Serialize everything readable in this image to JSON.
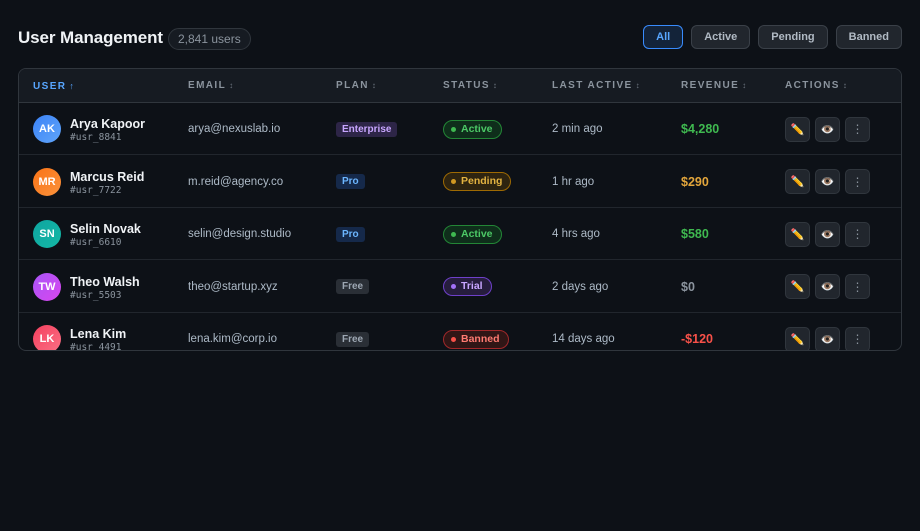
{
  "header": {
    "title": "User Management",
    "user_count": "2,841 users",
    "filters": [
      "All",
      "Active",
      "Pending",
      "Banned"
    ],
    "active_filter": "All"
  },
  "table": {
    "columns": [
      {
        "label": "USER",
        "sort": "↑",
        "sorted": true
      },
      {
        "label": "EMAIL",
        "sort": "↕",
        "sorted": false
      },
      {
        "label": "PLAN",
        "sort": "↕",
        "sorted": false
      },
      {
        "label": "STATUS",
        "sort": "↕",
        "sorted": false
      },
      {
        "label": "LAST ACTIVE",
        "sort": "↕",
        "sorted": false
      },
      {
        "label": "REVENUE",
        "sort": "↕",
        "sorted": false
      },
      {
        "label": "ACTIONS",
        "sort": "↕",
        "sorted": false
      }
    ],
    "rows": [
      {
        "initials": "AK",
        "avatar_colors": [
          "#3b82f6",
          "#60a5fa"
        ],
        "name": "Arya Kapoor",
        "id": "#usr_8841",
        "email": "arya@nexuslab.io",
        "plan": "Enterprise",
        "plan_type": "enterprise",
        "status": "Active",
        "status_type": "active",
        "last_active": "2 min ago",
        "revenue": "$4,280",
        "revenue_color": "#3fb950"
      },
      {
        "initials": "MR",
        "avatar_colors": [
          "#f97316",
          "#fb923c"
        ],
        "name": "Marcus Reid",
        "id": "#usr_7722",
        "email": "m.reid@agency.co",
        "plan": "Pro",
        "plan_type": "pro",
        "status": "Pending",
        "status_type": "pending",
        "last_active": "1 hr ago",
        "revenue": "$290",
        "revenue_color": "#e3a63c"
      },
      {
        "initials": "SN",
        "avatar_colors": [
          "#0ea5a0",
          "#14b8a6"
        ],
        "name": "Selin Novak",
        "id": "#usr_6610",
        "email": "selin@design.studio",
        "plan": "Pro",
        "plan_type": "pro",
        "status": "Active",
        "status_type": "active",
        "last_active": "4 hrs ago",
        "revenue": "$580",
        "revenue_color": "#3fb950"
      },
      {
        "initials": "TW",
        "avatar_colors": [
          "#a855f7",
          "#d946ef"
        ],
        "name": "Theo Walsh",
        "id": "#usr_5503",
        "email": "theo@startup.xyz",
        "plan": "Free",
        "plan_type": "free",
        "status": "Trial",
        "status_type": "trial",
        "last_active": "2 days ago",
        "revenue": "$0",
        "revenue_color": "#8b949e"
      },
      {
        "initials": "LK",
        "avatar_colors": [
          "#f43f5e",
          "#fb7185"
        ],
        "name": "Lena Kim",
        "id": "#usr_4491",
        "email": "lena.kim@corp.io",
        "plan": "Free",
        "plan_type": "free",
        "status": "Banned",
        "status_type": "banned",
        "last_active": "14 days ago",
        "revenue": "-$120",
        "revenue_color": "#f85149"
      }
    ],
    "action_icons": [
      "pencil-icon",
      "eye-icon",
      "more-icon"
    ]
  }
}
